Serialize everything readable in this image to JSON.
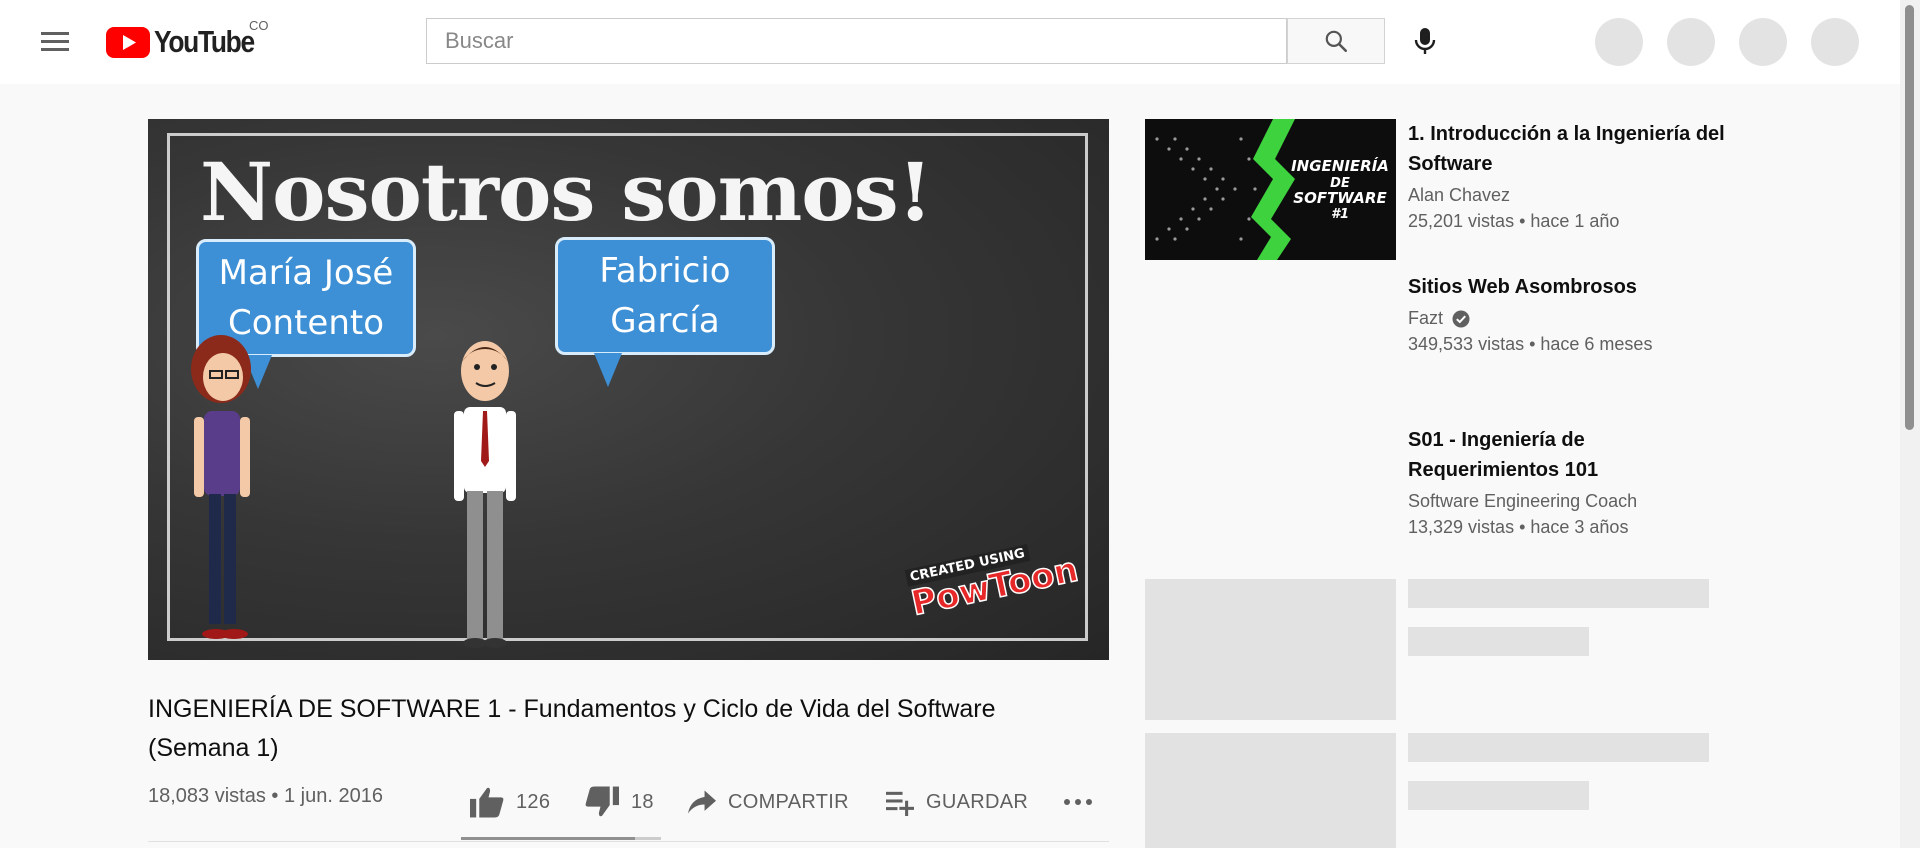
{
  "header": {
    "logo_text": "YouTube",
    "country_code": "CO",
    "search_placeholder": "Buscar",
    "menu_icon": "hamburger-icon",
    "search_icon": "magnifier-icon",
    "mic_icon": "microphone-icon",
    "accent_color": "#ff0000"
  },
  "player": {
    "slide_title": "Nosotros somos!",
    "bubble_left": [
      "María José",
      "Contento"
    ],
    "bubble_right": [
      "Fabricio",
      "García"
    ],
    "badge_top": "CREATED USING",
    "badge_main": "PowToon"
  },
  "video": {
    "title": "INGENIERÍA DE SOFTWARE 1 - Fundamentos y Ciclo de Vida del Software (Semana 1)",
    "views_date": "18,083 vistas • 1 jun. 2016",
    "like_count": "126",
    "dislike_count": "18",
    "share_label": "COMPARTIR",
    "save_label": "GUARDAR",
    "like_ratio": 0.87
  },
  "recommendations": [
    {
      "title": "1. Introducción a la Ingeniería del Software",
      "channel": "Alan Chavez",
      "meta": "25,201 vistas • hace 1 año",
      "verified": false,
      "thumb_text": [
        "INGENIERÍA",
        "DE",
        "SOFTWARE",
        "#1"
      ]
    },
    {
      "title": "Sitios Web Asombrosos",
      "channel": "Fazt",
      "meta": "349,533 vistas • hace 6 meses",
      "verified": true
    },
    {
      "title": "S01 - Ingeniería de Requerimientos 101",
      "channel": "Software Engineering Coach",
      "meta": "13,329 vistas • hace 3 años",
      "verified": false
    }
  ]
}
